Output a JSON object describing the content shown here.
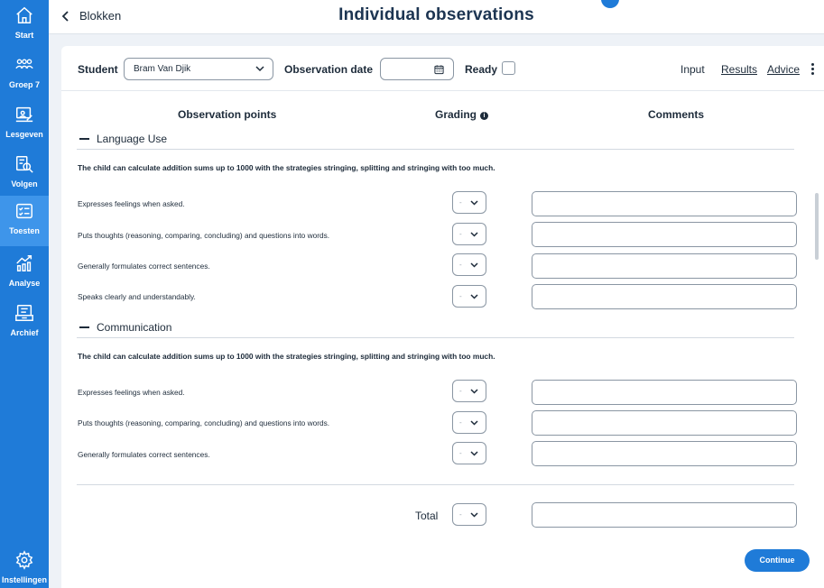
{
  "sidebar": {
    "items": [
      {
        "label": "Start",
        "icon": "home-icon"
      },
      {
        "label": "Groep 7",
        "icon": "group-icon"
      },
      {
        "label": "Lesgeven",
        "icon": "teach-icon"
      },
      {
        "label": "Volgen",
        "icon": "follow-icon"
      },
      {
        "label": "Toesten",
        "icon": "test-icon"
      },
      {
        "label": "Analyse",
        "icon": "chart-icon"
      },
      {
        "label": "Archief",
        "icon": "archive-icon"
      }
    ],
    "settings_label": "Instellingen",
    "active_index": 4
  },
  "header": {
    "back_label": "Blokken",
    "title": "Individual observations"
  },
  "filters": {
    "student_label": "Student",
    "student_value": "Bram Van Djik",
    "date_label": "Observation date",
    "date_value": "",
    "ready_label": "Ready",
    "ready_checked": false
  },
  "tabs": [
    {
      "label": "Input",
      "active": true
    },
    {
      "label": "Results",
      "active": false
    },
    {
      "label": "Advice",
      "active": false
    }
  ],
  "columns": {
    "points": "Observation points",
    "grading": "Grading",
    "comments": "Comments"
  },
  "sections": [
    {
      "title": "Language Use",
      "goal": "The child can calculate addition sums up to 1000 with the strategies stringing, splitting and stringing with too much.",
      "rows": [
        {
          "label": "Expresses feelings when asked.",
          "grade": "-",
          "comment": ""
        },
        {
          "label": "Puts thoughts (reasoning, comparing, concluding) and questions into words.",
          "grade": "-",
          "comment": ""
        },
        {
          "label": "Generally formulates correct sentences.",
          "grade": "-",
          "comment": ""
        },
        {
          "label": "Speaks clearly and understandably.",
          "grade": "-",
          "comment": ""
        }
      ]
    },
    {
      "title": "Communication",
      "goal": "The child can calculate addition sums up to 1000 with the strategies stringing, splitting and stringing with too much.",
      "rows": [
        {
          "label": "Expresses feelings when asked.",
          "grade": "-",
          "comment": ""
        },
        {
          "label": "Puts thoughts (reasoning, comparing, concluding) and questions into words.",
          "grade": "-",
          "comment": ""
        },
        {
          "label": "Generally formulates correct sentences.",
          "grade": "-",
          "comment": ""
        }
      ]
    }
  ],
  "total": {
    "label": "Total",
    "grade": "-",
    "comment": ""
  },
  "continue_label": "Continue",
  "colors": {
    "brand": "#1f7bd8",
    "sidebar_active": "#3e95ea"
  }
}
